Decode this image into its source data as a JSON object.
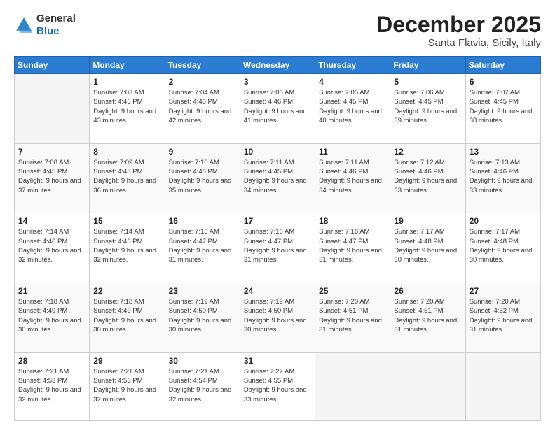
{
  "header": {
    "logo_general": "General",
    "logo_blue": "Blue",
    "month_title": "December 2025",
    "location": "Santa Flavia, Sicily, Italy"
  },
  "weekdays": [
    "Sunday",
    "Monday",
    "Tuesday",
    "Wednesday",
    "Thursday",
    "Friday",
    "Saturday"
  ],
  "weeks": [
    [
      {
        "day": "",
        "empty": true
      },
      {
        "day": "1",
        "sunrise": "Sunrise: 7:03 AM",
        "sunset": "Sunset: 4:46 PM",
        "daylight": "Daylight: 9 hours and 43 minutes."
      },
      {
        "day": "2",
        "sunrise": "Sunrise: 7:04 AM",
        "sunset": "Sunset: 4:46 PM",
        "daylight": "Daylight: 9 hours and 42 minutes."
      },
      {
        "day": "3",
        "sunrise": "Sunrise: 7:05 AM",
        "sunset": "Sunset: 4:46 PM",
        "daylight": "Daylight: 9 hours and 41 minutes."
      },
      {
        "day": "4",
        "sunrise": "Sunrise: 7:05 AM",
        "sunset": "Sunset: 4:45 PM",
        "daylight": "Daylight: 9 hours and 40 minutes."
      },
      {
        "day": "5",
        "sunrise": "Sunrise: 7:06 AM",
        "sunset": "Sunset: 4:45 PM",
        "daylight": "Daylight: 9 hours and 39 minutes."
      },
      {
        "day": "6",
        "sunrise": "Sunrise: 7:07 AM",
        "sunset": "Sunset: 4:45 PM",
        "daylight": "Daylight: 9 hours and 38 minutes."
      }
    ],
    [
      {
        "day": "7",
        "sunrise": "Sunrise: 7:08 AM",
        "sunset": "Sunset: 4:45 PM",
        "daylight": "Daylight: 9 hours and 37 minutes."
      },
      {
        "day": "8",
        "sunrise": "Sunrise: 7:09 AM",
        "sunset": "Sunset: 4:45 PM",
        "daylight": "Daylight: 9 hours and 36 minutes."
      },
      {
        "day": "9",
        "sunrise": "Sunrise: 7:10 AM",
        "sunset": "Sunset: 4:45 PM",
        "daylight": "Daylight: 9 hours and 35 minutes."
      },
      {
        "day": "10",
        "sunrise": "Sunrise: 7:11 AM",
        "sunset": "Sunset: 4:45 PM",
        "daylight": "Daylight: 9 hours and 34 minutes."
      },
      {
        "day": "11",
        "sunrise": "Sunrise: 7:11 AM",
        "sunset": "Sunset: 4:46 PM",
        "daylight": "Daylight: 9 hours and 34 minutes."
      },
      {
        "day": "12",
        "sunrise": "Sunrise: 7:12 AM",
        "sunset": "Sunset: 4:46 PM",
        "daylight": "Daylight: 9 hours and 33 minutes."
      },
      {
        "day": "13",
        "sunrise": "Sunrise: 7:13 AM",
        "sunset": "Sunset: 4:46 PM",
        "daylight": "Daylight: 9 hours and 33 minutes."
      }
    ],
    [
      {
        "day": "14",
        "sunrise": "Sunrise: 7:14 AM",
        "sunset": "Sunset: 4:46 PM",
        "daylight": "Daylight: 9 hours and 32 minutes."
      },
      {
        "day": "15",
        "sunrise": "Sunrise: 7:14 AM",
        "sunset": "Sunset: 4:46 PM",
        "daylight": "Daylight: 9 hours and 32 minutes."
      },
      {
        "day": "16",
        "sunrise": "Sunrise: 7:15 AM",
        "sunset": "Sunset: 4:47 PM",
        "daylight": "Daylight: 9 hours and 31 minutes."
      },
      {
        "day": "17",
        "sunrise": "Sunrise: 7:16 AM",
        "sunset": "Sunset: 4:47 PM",
        "daylight": "Daylight: 9 hours and 31 minutes."
      },
      {
        "day": "18",
        "sunrise": "Sunrise: 7:16 AM",
        "sunset": "Sunset: 4:47 PM",
        "daylight": "Daylight: 9 hours and 31 minutes."
      },
      {
        "day": "19",
        "sunrise": "Sunrise: 7:17 AM",
        "sunset": "Sunset: 4:48 PM",
        "daylight": "Daylight: 9 hours and 30 minutes."
      },
      {
        "day": "20",
        "sunrise": "Sunrise: 7:17 AM",
        "sunset": "Sunset: 4:48 PM",
        "daylight": "Daylight: 9 hours and 30 minutes."
      }
    ],
    [
      {
        "day": "21",
        "sunrise": "Sunrise: 7:18 AM",
        "sunset": "Sunset: 4:49 PM",
        "daylight": "Daylight: 9 hours and 30 minutes."
      },
      {
        "day": "22",
        "sunrise": "Sunrise: 7:18 AM",
        "sunset": "Sunset: 4:49 PM",
        "daylight": "Daylight: 9 hours and 30 minutes."
      },
      {
        "day": "23",
        "sunrise": "Sunrise: 7:19 AM",
        "sunset": "Sunset: 4:50 PM",
        "daylight": "Daylight: 9 hours and 30 minutes."
      },
      {
        "day": "24",
        "sunrise": "Sunrise: 7:19 AM",
        "sunset": "Sunset: 4:50 PM",
        "daylight": "Daylight: 9 hours and 30 minutes."
      },
      {
        "day": "25",
        "sunrise": "Sunrise: 7:20 AM",
        "sunset": "Sunset: 4:51 PM",
        "daylight": "Daylight: 9 hours and 31 minutes."
      },
      {
        "day": "26",
        "sunrise": "Sunrise: 7:20 AM",
        "sunset": "Sunset: 4:51 PM",
        "daylight": "Daylight: 9 hours and 31 minutes."
      },
      {
        "day": "27",
        "sunrise": "Sunrise: 7:20 AM",
        "sunset": "Sunset: 4:52 PM",
        "daylight": "Daylight: 9 hours and 31 minutes."
      }
    ],
    [
      {
        "day": "28",
        "sunrise": "Sunrise: 7:21 AM",
        "sunset": "Sunset: 4:53 PM",
        "daylight": "Daylight: 9 hours and 32 minutes."
      },
      {
        "day": "29",
        "sunrise": "Sunrise: 7:21 AM",
        "sunset": "Sunset: 4:53 PM",
        "daylight": "Daylight: 9 hours and 32 minutes."
      },
      {
        "day": "30",
        "sunrise": "Sunrise: 7:21 AM",
        "sunset": "Sunset: 4:54 PM",
        "daylight": "Daylight: 9 hours and 32 minutes."
      },
      {
        "day": "31",
        "sunrise": "Sunrise: 7:22 AM",
        "sunset": "Sunset: 4:55 PM",
        "daylight": "Daylight: 9 hours and 33 minutes."
      },
      {
        "day": "",
        "empty": true
      },
      {
        "day": "",
        "empty": true
      },
      {
        "day": "",
        "empty": true
      }
    ]
  ]
}
